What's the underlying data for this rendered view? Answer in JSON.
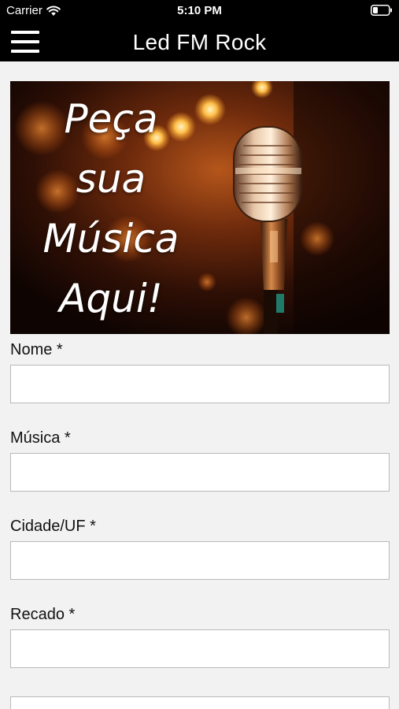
{
  "status_bar": {
    "carrier": "Carrier",
    "time": "5:10 PM",
    "icons": [
      "wifi-icon",
      "battery-icon"
    ]
  },
  "nav": {
    "title": "Led FM Rock",
    "menu_icon": "hamburger-menu-icon"
  },
  "banner": {
    "lines": [
      "Peça",
      "sua",
      "Música",
      "Aqui!"
    ],
    "image": "microphone-photo"
  },
  "form": {
    "fields": [
      {
        "label": "Nome *",
        "value": "",
        "placeholder": ""
      },
      {
        "label": "Música *",
        "value": "",
        "placeholder": ""
      },
      {
        "label": "Cidade/UF *",
        "value": "",
        "placeholder": ""
      },
      {
        "label": "Recado *",
        "value": "",
        "placeholder": ""
      }
    ]
  },
  "colors": {
    "header_bg": "#000000",
    "page_bg": "#f2f2f2",
    "input_border": "#b9b9b9"
  }
}
